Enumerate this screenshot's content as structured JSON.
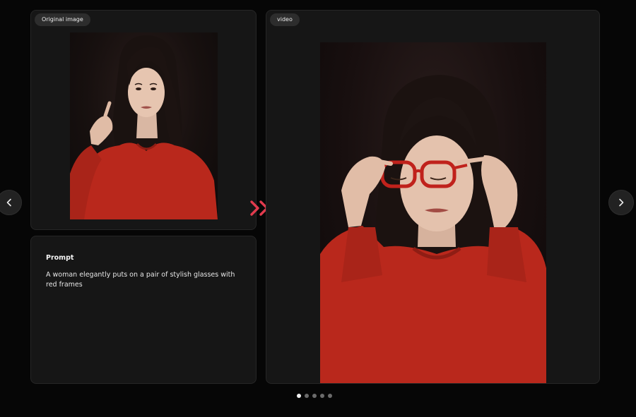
{
  "original_card": {
    "tag": "Original image",
    "image_alt": "woman in red sweater with hand near chin"
  },
  "prompt_card": {
    "heading": "Prompt",
    "text": "A woman elegantly puts on a pair of stylish glasses with red frames"
  },
  "video_card": {
    "tag": "video",
    "image_alt": "woman in red sweater putting on red-framed glasses"
  },
  "icons": {
    "transform": "double-chevron-right-icon",
    "prev": "chevron-left-icon",
    "next": "chevron-right-icon"
  },
  "colors": {
    "background": "#060606",
    "card": "#161616",
    "accent": "#e23b4e",
    "sweater": "#b9281c"
  },
  "pagination": {
    "total": 5,
    "active_index": 0
  }
}
